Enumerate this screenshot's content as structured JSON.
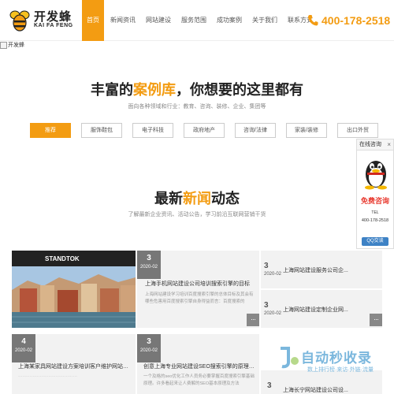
{
  "header": {
    "logo_cn": "开发蜂",
    "logo_en": "KAI FA FENG",
    "nav": [
      "首页",
      "新闻资讯",
      "网站建设",
      "服务范围",
      "成功案例",
      "关于我们",
      "联系方式"
    ],
    "phone": "400-178-2518"
  },
  "banner": {
    "alt": "开发蜂"
  },
  "cases": {
    "title_pre": "丰富的",
    "title_hl": "案例库",
    "title_post": "，你想要的这里都有",
    "subtitle": "面向各种领域和行业：教育、咨询、装修、企业、集团等",
    "tabs": [
      "推荐",
      "服饰鞋包",
      "电子科技",
      "政府地产",
      "咨询/法律",
      "家装/装修",
      "出口外贸"
    ]
  },
  "news": {
    "title_pre": "最新",
    "title_hl": "新闻",
    "title_post": "动态",
    "subtitle": "了解最新企业资讯、活动公告，学习前沿互联网营销干货",
    "image_text": "STANDTOK",
    "items": [
      {
        "day": "3",
        "ym": "2020-02",
        "title": "上海手机网站建设公司培训搜索引擎的目标",
        "desc": "上海网站建设学习培训百度搜索引擎的总体目标及其会有哪些危害用百度搜索引擎自身得益而言：百度搜索的"
      },
      {
        "day": "3",
        "ym": "2020-02",
        "title": "上海网站建设服务公司企..."
      },
      {
        "day": "3",
        "ym": "2020-02",
        "title": "上海网站建设定制企业网..."
      },
      {
        "day": "4",
        "ym": "2020-02",
        "title": "上海某家具网站建设方案培训客户维护网站操作..."
      },
      {
        "day": "3",
        "ym": "2020-02",
        "title": "创意上海专业网站建设SEO搜索引擎的原理是什...",
        "desc": "一个及格的seo优化工作人员务必要掌握百度搜索引擎基础原理。许多看起来让人费解的SEO基本原理及方法"
      },
      {
        "day": "3",
        "ym": "2020-02",
        "title": "上海长宁网站建设公司设..."
      }
    ]
  },
  "qq_widget": {
    "title": "在线咨询",
    "close": "×",
    "free": "免费咨询",
    "tel_label": "TEL",
    "tel": "400-178-2518",
    "button": "QQ交谈"
  },
  "watermark": {
    "text": "自动秒收录",
    "sub": "数上排行榜·来访·外链·流量"
  },
  "colors": {
    "accent": "#f39c12",
    "qq_button": "#3e82c5",
    "date_box": "#777777"
  }
}
